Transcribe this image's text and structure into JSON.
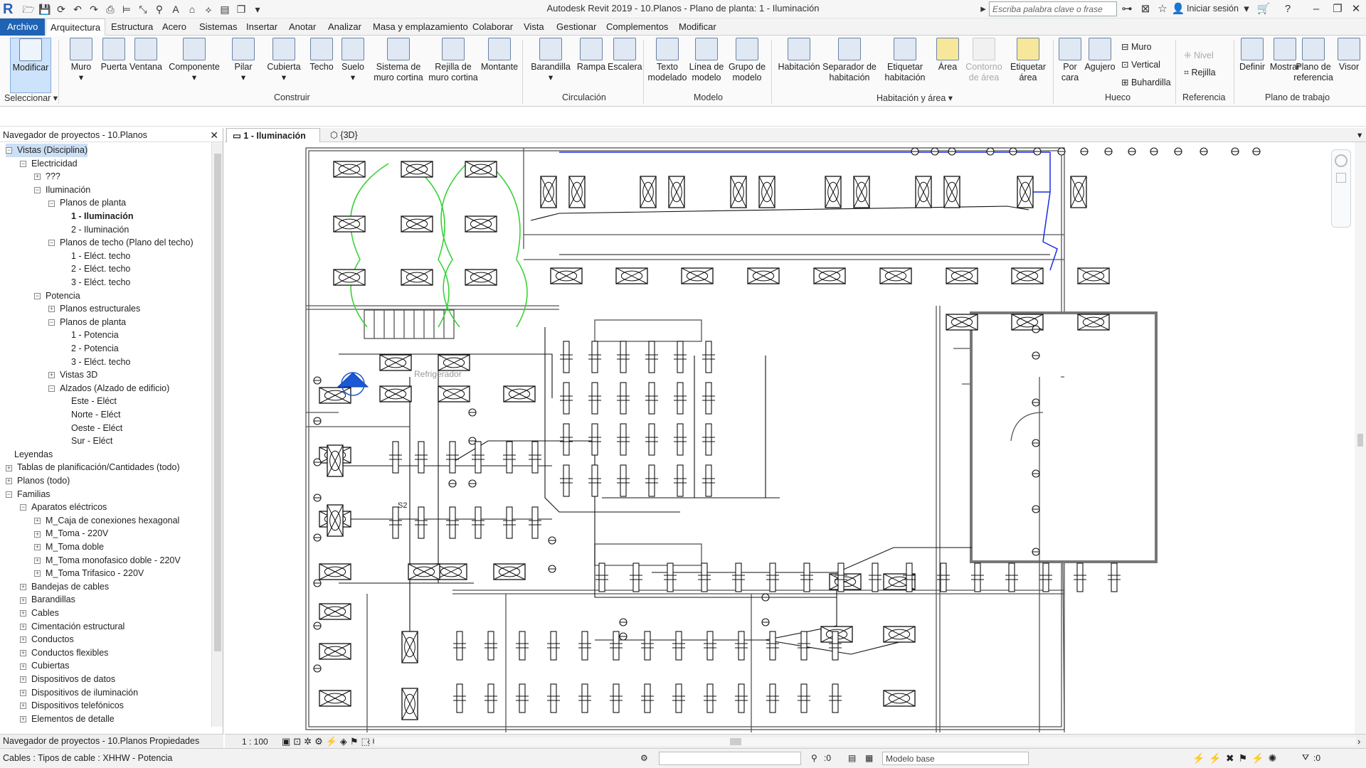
{
  "app": {
    "title": "Autodesk Revit 2019 - 10.Planos - Plano de planta: 1 - Iluminación",
    "search_placeholder": "Escriba palabra clave o frase",
    "signin": "Iniciar sesión"
  },
  "menu": {
    "tabs": [
      "Archivo",
      "Arquitectura",
      "Estructura",
      "Acero",
      "Sistemas",
      "Insertar",
      "Anotar",
      "Analizar",
      "Masa y emplazamiento",
      "Colaborar",
      "Vista",
      "Gestionar",
      "Complementos",
      "Modificar"
    ],
    "active": "Arquitectura"
  },
  "ribbon": {
    "modificar": "Modificar",
    "seleccionar": "Seleccionar",
    "construir": {
      "label": "Construir",
      "items": [
        "Muro",
        "Puerta",
        "Ventana",
        "Componente",
        "Pilar",
        "Cubierta",
        "Techo",
        "Suelo",
        "Sistema de muro cortina",
        "Rejilla de muro cortina",
        "Montante"
      ]
    },
    "circulacion": {
      "label": "Circulación",
      "items": [
        "Barandilla",
        "Rampa",
        "Escalera"
      ]
    },
    "modelo": {
      "label": "Modelo",
      "items": [
        "Texto modelado",
        "Línea de modelo",
        "Grupo de modelo"
      ]
    },
    "habitacion": {
      "label": "Habitación y área",
      "items": [
        "Habitación",
        "Separador de habitación",
        "Etiquetar habitación",
        "Área",
        "Contorno de área",
        "Etiquetar área"
      ]
    },
    "hueco": {
      "label": "Hueco",
      "items": [
        "Por cara",
        "Agujero",
        "Muro",
        "Vertical",
        "Buhardilla"
      ]
    },
    "referencia": {
      "label": "Referencia",
      "items": [
        "Nivel",
        "Rejilla"
      ]
    },
    "plano_trabajo": {
      "label": "Plano de trabajo",
      "items": [
        "Definir",
        "Mostrar",
        "Plano de referencia",
        "Visor"
      ]
    }
  },
  "browser": {
    "title": "Navegador de proyectos - 10.Planos",
    "nodes": [
      {
        "label": "Vistas (Disciplina)",
        "level": 0,
        "toggle": "-",
        "selected": true
      },
      {
        "label": "Electricidad",
        "level": 1,
        "toggle": "-"
      },
      {
        "label": "???",
        "level": 2,
        "toggle": "+"
      },
      {
        "label": "Iluminación",
        "level": 2,
        "toggle": "-"
      },
      {
        "label": "Planos de planta",
        "level": 3,
        "toggle": "-"
      },
      {
        "label": "1 - Iluminación",
        "level": 4,
        "toggle": "",
        "bold": true
      },
      {
        "label": "2 - Iluminación",
        "level": 4,
        "toggle": ""
      },
      {
        "label": "Planos de techo (Plano del techo)",
        "level": 3,
        "toggle": "-"
      },
      {
        "label": "1 - Eléct. techo",
        "level": 4,
        "toggle": ""
      },
      {
        "label": "2 - Eléct. techo",
        "level": 4,
        "toggle": ""
      },
      {
        "label": "3 - Eléct. techo",
        "level": 4,
        "toggle": ""
      },
      {
        "label": "Potencia",
        "level": 2,
        "toggle": "-"
      },
      {
        "label": "Planos estructurales",
        "level": 3,
        "toggle": "+"
      },
      {
        "label": "Planos de planta",
        "level": 3,
        "toggle": "-"
      },
      {
        "label": "1 - Potencia",
        "level": 4,
        "toggle": ""
      },
      {
        "label": "2 - Potencia",
        "level": 4,
        "toggle": ""
      },
      {
        "label": "3 - Eléct. techo",
        "level": 4,
        "toggle": ""
      },
      {
        "label": "Vistas 3D",
        "level": 3,
        "toggle": "+"
      },
      {
        "label": "Alzados (Alzado de edificio)",
        "level": 3,
        "toggle": "-"
      },
      {
        "label": "Este - Eléct",
        "level": 4,
        "toggle": ""
      },
      {
        "label": "Norte - Eléct",
        "level": 4,
        "toggle": ""
      },
      {
        "label": "Oeste - Eléct",
        "level": 4,
        "toggle": ""
      },
      {
        "label": "Sur - Eléct",
        "level": 4,
        "toggle": ""
      },
      {
        "label": "Leyendas",
        "level": 0,
        "toggle": ""
      },
      {
        "label": "Tablas de planificación/Cantidades (todo)",
        "level": 0,
        "toggle": "+"
      },
      {
        "label": "Planos (todo)",
        "level": 0,
        "toggle": "+"
      },
      {
        "label": "Familias",
        "level": 0,
        "toggle": "-"
      },
      {
        "label": "Aparatos eléctricos",
        "level": 1,
        "toggle": "-"
      },
      {
        "label": "M_Caja de conexiones hexagonal",
        "level": 2,
        "toggle": "+"
      },
      {
        "label": "M_Toma - 220V",
        "level": 2,
        "toggle": "+"
      },
      {
        "label": "M_Toma doble",
        "level": 2,
        "toggle": "+"
      },
      {
        "label": "M_Toma monofasico doble - 220V",
        "level": 2,
        "toggle": "+"
      },
      {
        "label": "M_Toma Trifasico - 220V",
        "level": 2,
        "toggle": "+"
      },
      {
        "label": "Bandejas de cables",
        "level": 1,
        "toggle": "+"
      },
      {
        "label": "Barandillas",
        "level": 1,
        "toggle": "+"
      },
      {
        "label": "Cables",
        "level": 1,
        "toggle": "+"
      },
      {
        "label": "Cimentación estructural",
        "level": 1,
        "toggle": "+"
      },
      {
        "label": "Conductos",
        "level": 1,
        "toggle": "+"
      },
      {
        "label": "Conductos flexibles",
        "level": 1,
        "toggle": "+"
      },
      {
        "label": "Cubiertas",
        "level": 1,
        "toggle": "+"
      },
      {
        "label": "Dispositivos de datos",
        "level": 1,
        "toggle": "+"
      },
      {
        "label": "Dispositivos de iluminación",
        "level": 1,
        "toggle": "+"
      },
      {
        "label": "Dispositivos telefónicos",
        "level": 1,
        "toggle": "+"
      },
      {
        "label": "Elementos de detalle",
        "level": 1,
        "toggle": "+"
      }
    ],
    "tab_browser": "Navegador de proyectos - 10.Planos",
    "tab_properties": "Propiedades"
  },
  "view": {
    "tab_active": "1 - Iluminación",
    "tab_other": "{3D}",
    "scale": "1 : 100",
    "refrig_label": "Refrigerador",
    "tag_s2": "S2"
  },
  "status": {
    "message": "Cables : Tipos de cable : XHHW - Potencia",
    "filter_count": ":0",
    "model": "Modelo base",
    "sel_count": ":0"
  },
  "colors": {
    "accent": "#1e63b4",
    "circuit_green": "#2fd12f",
    "circuit_blue": "#1a2ce8"
  }
}
